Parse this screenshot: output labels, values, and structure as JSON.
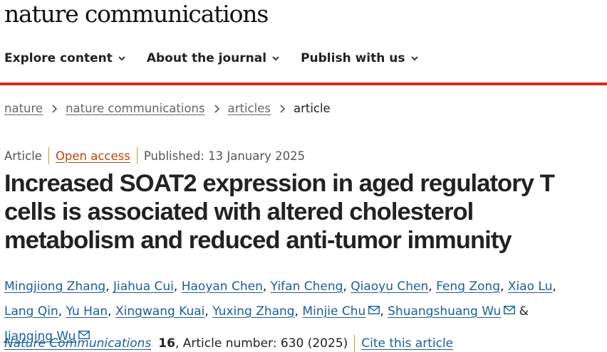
{
  "brand": "nature communications",
  "nav": [
    "Explore content",
    "About the journal",
    "Publish with us"
  ],
  "breadcrumb": {
    "items": [
      "nature",
      "nature communications",
      "articles"
    ],
    "current": "article"
  },
  "meta": {
    "type": "Article",
    "access": "Open access",
    "published": "Published: 13 January 2025"
  },
  "title": "Increased SOAT2 expression in aged regulatory T cells is associated with altered cholesterol metabolism and reduced anti-tumor immunity",
  "authors": [
    {
      "name": "Mingjiong Zhang",
      "email": false
    },
    {
      "name": "Jiahua Cui",
      "email": false
    },
    {
      "name": "Haoyan Chen",
      "email": false
    },
    {
      "name": "Yifan Cheng",
      "email": false
    },
    {
      "name": "Qiaoyu Chen",
      "email": false
    },
    {
      "name": "Feng Zong",
      "email": false
    },
    {
      "name": "Xiao Lu",
      "email": false
    },
    {
      "name": "Lang Qin",
      "email": false
    },
    {
      "name": "Yu Han",
      "email": false
    },
    {
      "name": "Xingwang Kuai",
      "email": false
    },
    {
      "name": "Yuxing Zhang",
      "email": false
    },
    {
      "name": "Minjie Chu",
      "email": true
    },
    {
      "name": "Shuangshuang Wu",
      "email": true
    },
    {
      "name": "Jianqing Wu",
      "email": true
    }
  ],
  "citation": {
    "journal": "Nature Communications",
    "volume": "16",
    "article_number": ", Article number: 630 (2025)",
    "cite_link": "Cite this article"
  },
  "colors": {
    "accent_red": "#d82b1f",
    "link_blue": "#1a5e9e",
    "open_access": "#c2410c",
    "divider": "#c8a020"
  }
}
